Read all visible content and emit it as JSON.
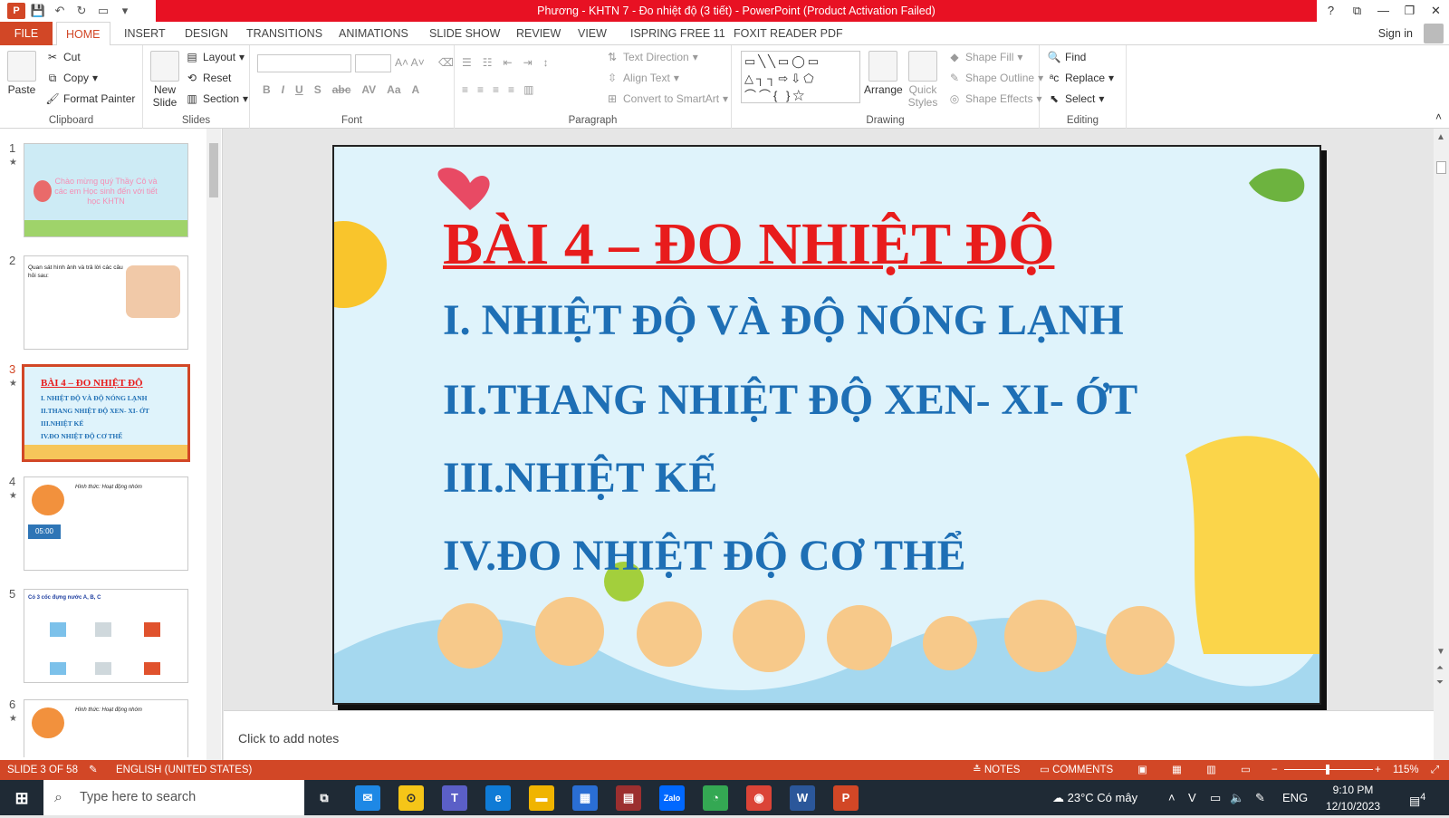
{
  "window": {
    "title": "Phương - KHTN 7 - Đo nhiệt độ (3 tiết) - PowerPoint (Product Activation Failed)",
    "controls": [
      "?",
      "⧉",
      "—",
      "❐",
      "✕"
    ]
  },
  "ribbon_tabs": {
    "file": "FILE",
    "items": [
      "HOME",
      "INSERT",
      "DESIGN",
      "TRANSITIONS",
      "ANIMATIONS",
      "SLIDE SHOW",
      "REVIEW",
      "VIEW",
      "ISPRING FREE 11",
      "FOXIT READER PDF"
    ],
    "active": "HOME",
    "signin": "Sign in"
  },
  "ribbon": {
    "clipboard": {
      "label": "Clipboard",
      "paste": "Paste",
      "cut": "Cut",
      "copy": "Copy",
      "format_painter": "Format Painter"
    },
    "slides": {
      "label": "Slides",
      "new_slide": "New Slide",
      "layout": "Layout",
      "reset": "Reset",
      "section": "Section"
    },
    "font": {
      "label": "Font"
    },
    "paragraph": {
      "label": "Paragraph",
      "text_direction": "Text Direction",
      "align_text": "Align Text",
      "convert_smartart": "Convert to SmartArt"
    },
    "drawing": {
      "label": "Drawing",
      "arrange": "Arrange",
      "quick_styles": "Quick Styles",
      "shape_fill": "Shape Fill",
      "shape_outline": "Shape Outline",
      "shape_effects": "Shape Effects"
    },
    "editing": {
      "label": "Editing",
      "find": "Find",
      "replace": "Replace",
      "select": "Select"
    }
  },
  "thumbnails": [
    {
      "num": "1",
      "text": "Chào mừng quý Thầy Cô và các em Học sinh đến với tiết học KHTN"
    },
    {
      "num": "2",
      "text": "Quan sát hình ảnh và trả lời các câu hỏi sau:"
    },
    {
      "num": "3",
      "title": "BÀI 4 – ĐO NHIỆT ĐỘ",
      "lines": [
        "I. NHIỆT ĐỘ VÀ ĐỘ NÓNG LẠNH",
        "II.THANG NHIỆT ĐỘ XEN- XI- ỚT",
        "III.NHIỆT KẾ",
        "IV.ĐO NHIỆT ĐỘ CƠ THỂ"
      ]
    },
    {
      "num": "4",
      "text": "Hình thức: Hoạt động nhóm",
      "timer": "05:00"
    },
    {
      "num": "5",
      "text": "Có 3 cốc đựng nước A, B, C"
    },
    {
      "num": "6",
      "text": "Hình thức: Hoạt động nhóm"
    }
  ],
  "slide": {
    "title": "BÀI 4 – ĐO NHIỆT ĐỘ",
    "lines": [
      "I. NHIỆT ĐỘ VÀ ĐỘ NÓNG LẠNH",
      "II.THANG NHIỆT ĐỘ XEN- XI- ỚT",
      "III.NHIỆT KẾ",
      "IV.ĐO NHIỆT ĐỘ CƠ THỂ"
    ]
  },
  "notes_placeholder": "Click to add notes",
  "status": {
    "slide_info": "SLIDE 3 OF 58",
    "language": "ENGLISH (UNITED STATES)",
    "notes": "NOTES",
    "comments": "COMMENTS",
    "zoom": "115%"
  },
  "taskbar": {
    "search_placeholder": "Type here to search",
    "weather": "23°C  Có mây",
    "lang": "ENG",
    "time": "9:10 PM",
    "date": "12/10/2023",
    "notif_count": "4"
  }
}
